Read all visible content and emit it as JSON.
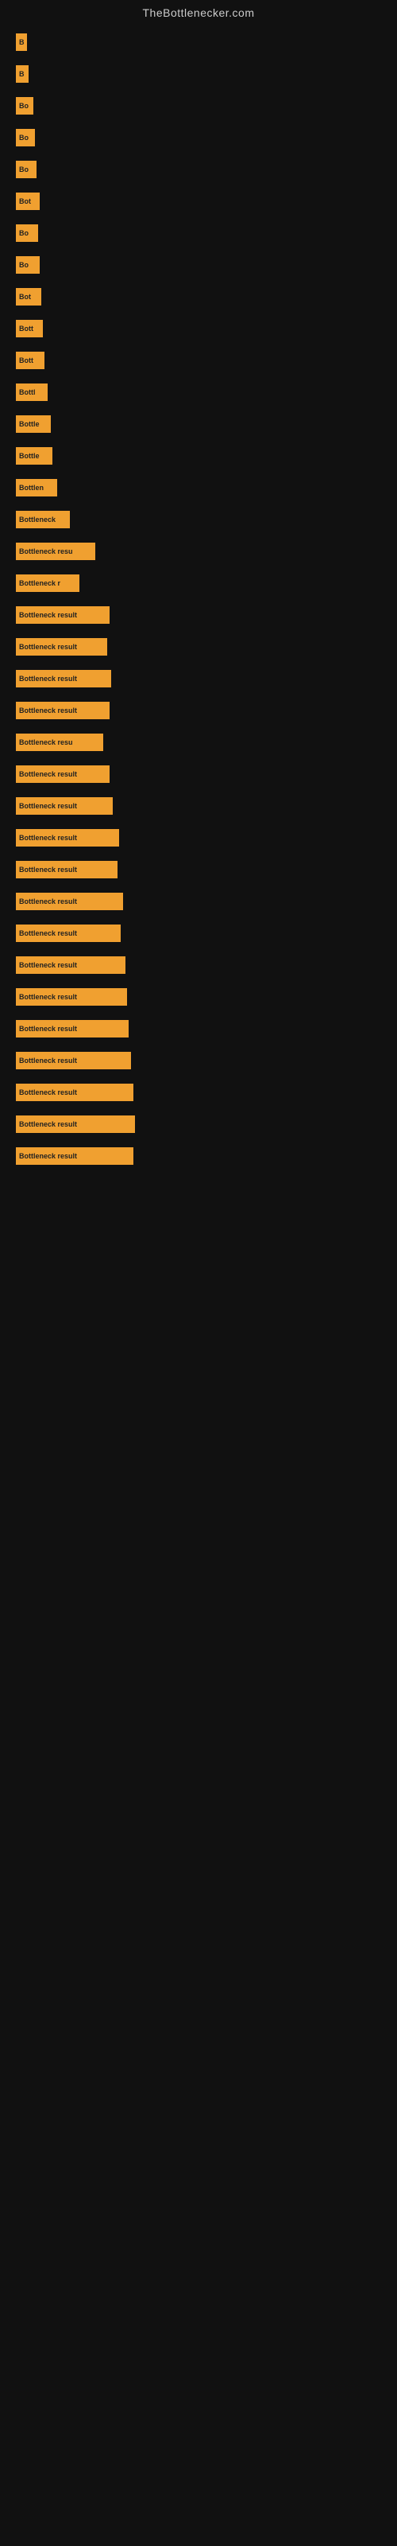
{
  "site": {
    "title": "TheBottlenecker.com"
  },
  "bars": [
    {
      "label": "B",
      "width": 14
    },
    {
      "label": "B",
      "width": 16
    },
    {
      "label": "Bo",
      "width": 22
    },
    {
      "label": "Bo",
      "width": 24
    },
    {
      "label": "Bo",
      "width": 26
    },
    {
      "label": "Bot",
      "width": 30
    },
    {
      "label": "Bo",
      "width": 28
    },
    {
      "label": "Bo",
      "width": 30
    },
    {
      "label": "Bot",
      "width": 32
    },
    {
      "label": "Bott",
      "width": 34
    },
    {
      "label": "Bott",
      "width": 36
    },
    {
      "label": "Bottl",
      "width": 40
    },
    {
      "label": "Bottle",
      "width": 44
    },
    {
      "label": "Bottle",
      "width": 46
    },
    {
      "label": "Bottlen",
      "width": 52
    },
    {
      "label": "Bottleneck",
      "width": 68
    },
    {
      "label": "Bottleneck resu",
      "width": 100
    },
    {
      "label": "Bottleneck r",
      "width": 80
    },
    {
      "label": "Bottleneck result",
      "width": 118
    },
    {
      "label": "Bottleneck result",
      "width": 115
    },
    {
      "label": "Bottleneck result",
      "width": 120
    },
    {
      "label": "Bottleneck result",
      "width": 118
    },
    {
      "label": "Bottleneck resu",
      "width": 110
    },
    {
      "label": "Bottleneck result",
      "width": 118
    },
    {
      "label": "Bottleneck result",
      "width": 122
    },
    {
      "label": "Bottleneck result",
      "width": 130
    },
    {
      "label": "Bottleneck result",
      "width": 128
    },
    {
      "label": "Bottleneck result",
      "width": 135
    },
    {
      "label": "Bottleneck result",
      "width": 132
    },
    {
      "label": "Bottleneck result",
      "width": 138
    },
    {
      "label": "Bottleneck result",
      "width": 140
    },
    {
      "label": "Bottleneck result",
      "width": 142
    },
    {
      "label": "Bottleneck result",
      "width": 145
    },
    {
      "label": "Bottleneck result",
      "width": 148
    },
    {
      "label": "Bottleneck result",
      "width": 150
    },
    {
      "label": "Bottleneck result",
      "width": 148
    }
  ]
}
